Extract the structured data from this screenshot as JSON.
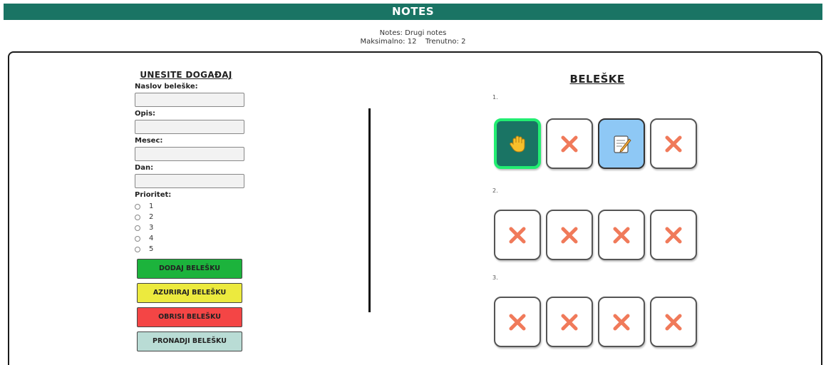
{
  "header": {
    "title": "NOTES"
  },
  "info": {
    "notes_label": "Notes:",
    "notes_value": "Drugi notes",
    "max_label": "Maksimalno:",
    "max_value": "12",
    "current_label": "Trenutno:",
    "current_value": "2"
  },
  "form": {
    "title": "UNESITE DOGAĐAJ",
    "fields": {
      "naslov": {
        "label": "Naslov beleške:",
        "value": ""
      },
      "opis": {
        "label": "Opis:",
        "value": ""
      },
      "mesec": {
        "label": "Mesec:",
        "value": ""
      },
      "dan": {
        "label": "Dan:",
        "value": ""
      }
    },
    "priority_label": "Prioritet:",
    "priorities": [
      "1",
      "2",
      "3",
      "4",
      "5"
    ],
    "buttons": {
      "add": "DODAJ BELEŠKU",
      "update": "AZURIRAJ BELEŠKU",
      "delete": "OBRISI BELEŠKU",
      "find": "PRONADJI BELEŠKU"
    }
  },
  "notes": {
    "title": "BELEŠKE",
    "rows": [
      {
        "label": "1.",
        "slots": [
          "hand-icon",
          "cross-icon",
          "memo-icon",
          "cross-icon"
        ]
      },
      {
        "label": "2.",
        "slots": [
          "cross-icon",
          "cross-icon",
          "cross-icon",
          "cross-icon"
        ]
      },
      {
        "label": "3.",
        "slots": [
          "cross-icon",
          "cross-icon",
          "cross-icon",
          "cross-icon"
        ]
      }
    ]
  },
  "colors": {
    "header_bg": "#1a7464",
    "active_slot_bg": "#1a7464",
    "active_slot_border": "#22ee72",
    "edit_slot_bg": "#8ec8f5",
    "cross": "#f07a5a",
    "btn_add": "#1cb33c",
    "btn_update": "#ecea3e",
    "btn_delete": "#f44545",
    "btn_find": "#b9dcd5"
  }
}
